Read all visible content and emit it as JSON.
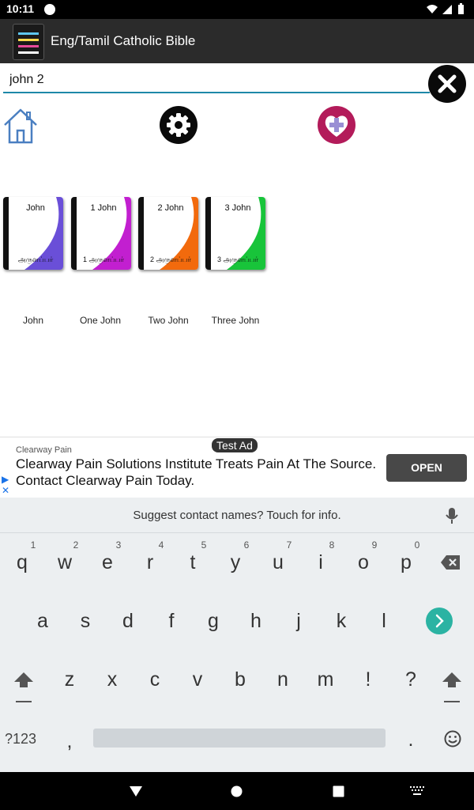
{
  "status_bar": {
    "time": "10:11"
  },
  "app_bar": {
    "title": "Eng/Tamil Catholic Bible"
  },
  "search": {
    "value": "john 2"
  },
  "books": [
    {
      "cover_title": "John",
      "cover_subtitle": "அருளப்பர்",
      "label": "John",
      "color": "#6a4fd8"
    },
    {
      "cover_title": "1 John",
      "cover_subtitle": "1  அருளப்பர்",
      "label": "One John",
      "color": "#c21fd0"
    },
    {
      "cover_title": "2 John",
      "cover_subtitle": "2  அருளப்பர்",
      "label": "Two John",
      "color": "#f26a0d"
    },
    {
      "cover_title": "3 John",
      "cover_subtitle": "3  அருளப்பர்",
      "label": "Three John",
      "color": "#18c43a"
    }
  ],
  "ad": {
    "badge": "Test Ad",
    "advertiser": "Clearway Pain",
    "headline": "Clearway Pain Solutions Institute Treats Pain At The Source. Contact Clearway Pain Today.",
    "cta": "OPEN"
  },
  "keyboard": {
    "suggestion": "Suggest contact names? Touch for info.",
    "row1_numbers": [
      "1",
      "2",
      "3",
      "4",
      "5",
      "6",
      "7",
      "8",
      "9",
      "0"
    ],
    "row1": [
      "q",
      "w",
      "e",
      "r",
      "t",
      "y",
      "u",
      "i",
      "o",
      "p"
    ],
    "row2": [
      "a",
      "s",
      "d",
      "f",
      "g",
      "h",
      "j",
      "k",
      "l"
    ],
    "row3": [
      "z",
      "x",
      "c",
      "v",
      "b",
      "n",
      "m",
      "!",
      "?"
    ],
    "symbols_key": "?123",
    "comma": ",",
    "period": "."
  }
}
